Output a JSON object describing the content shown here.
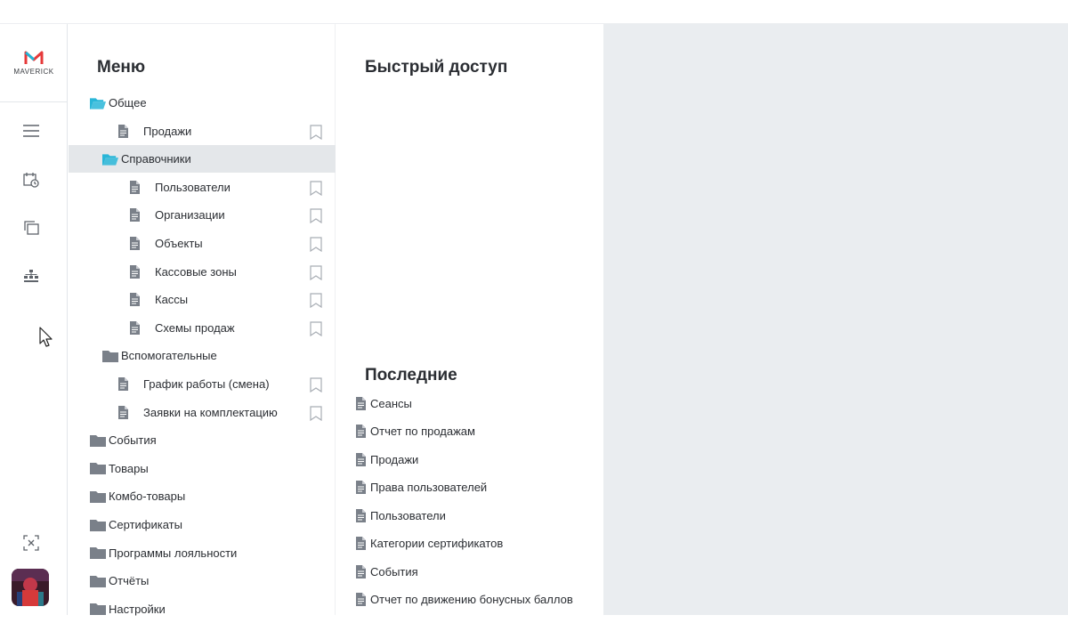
{
  "brand": {
    "logo_text": "MAVERICK",
    "accent": "#e6393a",
    "accent2": "#22b5d6"
  },
  "rail": {
    "icons": [
      {
        "name": "hamburger-menu-icon"
      },
      {
        "name": "calendar-clock-icon"
      },
      {
        "name": "copy-windows-icon"
      },
      {
        "name": "hierarchy-icon"
      },
      {
        "name": "close-panels-icon"
      }
    ]
  },
  "menu": {
    "title": "Меню",
    "items": [
      {
        "label": "Общее",
        "type": "folder-open",
        "level": 0
      },
      {
        "label": "Продажи",
        "type": "doc",
        "level": 1,
        "bookmark": true
      },
      {
        "label": "Справочники",
        "type": "folder-open",
        "level": 1,
        "selected": true
      },
      {
        "label": "Пользователи",
        "type": "doc",
        "level": 2,
        "bookmark": true
      },
      {
        "label": "Организации",
        "type": "doc",
        "level": 2,
        "bookmark": true
      },
      {
        "label": "Объекты",
        "type": "doc",
        "level": 2,
        "bookmark": true
      },
      {
        "label": "Кассовые зоны",
        "type": "doc",
        "level": 2,
        "bookmark": true
      },
      {
        "label": "Кассы",
        "type": "doc",
        "level": 2,
        "bookmark": true
      },
      {
        "label": "Схемы продаж",
        "type": "doc",
        "level": 2,
        "bookmark": true
      },
      {
        "label": "Вспомогательные",
        "type": "folder",
        "level": 1
      },
      {
        "label": "График работы (смена)",
        "type": "doc",
        "level": 1,
        "bookmark": true
      },
      {
        "label": "Заявки на комплектацию",
        "type": "doc",
        "level": 1,
        "bookmark": true
      },
      {
        "label": "События",
        "type": "folder",
        "level": 0
      },
      {
        "label": "Товары",
        "type": "folder",
        "level": 0
      },
      {
        "label": "Комбо-товары",
        "type": "folder",
        "level": 0
      },
      {
        "label": "Сертификаты",
        "type": "folder",
        "level": 0
      },
      {
        "label": "Программы лояльности",
        "type": "folder",
        "level": 0
      },
      {
        "label": "Отчёты",
        "type": "folder",
        "level": 0
      },
      {
        "label": "Настройки",
        "type": "folder",
        "level": 0
      }
    ]
  },
  "quick_access": {
    "title": "Быстрый доступ"
  },
  "recent": {
    "title": "Последние",
    "items": [
      "Сеансы",
      "Отчет по продажам",
      "Продажи",
      "Права пользователей",
      "Пользователи",
      "Категории сертификатов",
      "События",
      "Отчет по движению бонусных баллов"
    ]
  },
  "colors": {
    "folder_open": "#29b6d8",
    "folder": "#7a8089",
    "doc": "#7a8089",
    "bookmark": "#a8adb4",
    "selected_bg": "#e4e7ea",
    "right_panel_bg": "#eaedf0"
  }
}
